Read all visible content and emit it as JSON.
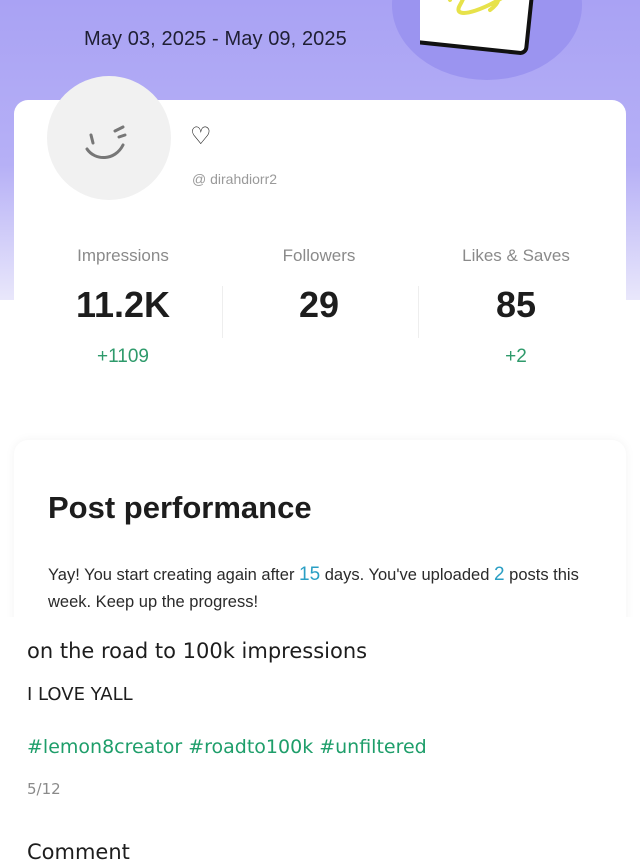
{
  "report": {
    "date_range": "May 03, 2025 - May 09, 2025"
  },
  "profile": {
    "handle": "@ dirahdiorr2",
    "heart_icon": "heart-outline-icon"
  },
  "stats": [
    {
      "label": "Impressions",
      "value": "11.2K",
      "delta": "+1109"
    },
    {
      "label": "Followers",
      "value": "29",
      "delta": ""
    },
    {
      "label": "Likes & Saves",
      "value": "85",
      "delta": "+2"
    }
  ],
  "post_performance": {
    "title": "Post performance",
    "text_part1": "Yay! You start creating again after ",
    "days": "15",
    "text_part2": " days. You've uploaded ",
    "posts": "2",
    "text_part3": " posts this week. Keep up the progress!"
  },
  "caption": {
    "title": "on the road to 100k impressions",
    "body": "I LOVE YALL",
    "hashtags": [
      "#lemon8creator",
      "#roadto100k",
      "#unfiltered"
    ],
    "page_indicator": "5/12",
    "comment_label": "Comment"
  },
  "colors": {
    "accent_purple": "#a9a2f4",
    "delta_green": "#2e9a6b",
    "highlight_blue": "#2a9fc4",
    "hashtag_green": "#1e9e6a"
  }
}
